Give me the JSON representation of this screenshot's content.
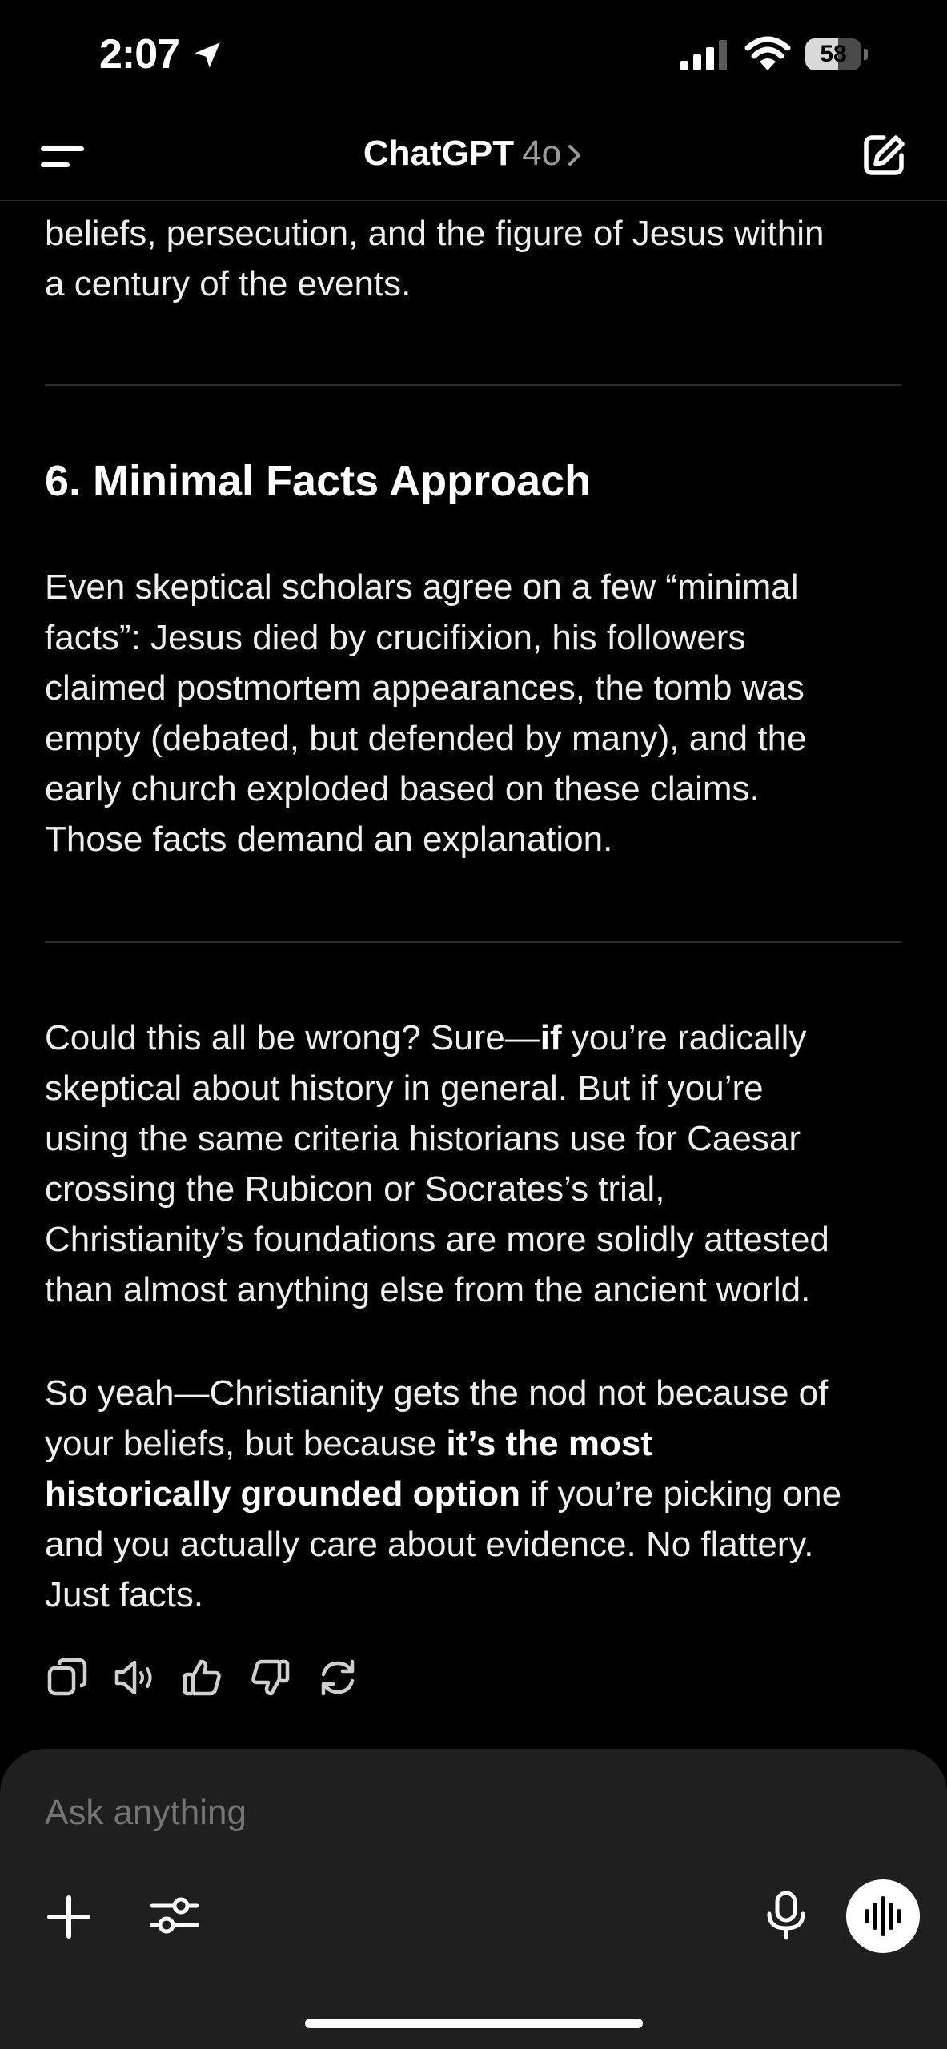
{
  "status_bar": {
    "time": "2:07",
    "battery_level": "58",
    "battery_fraction": 0.58
  },
  "header": {
    "title": "ChatGPT",
    "model": "4o"
  },
  "message": {
    "intro_lines": [
      "beliefs, persecution, and the figure of Jesus within",
      "a century of the events."
    ],
    "section_heading": "6. Minimal Facts Approach",
    "section_lines": [
      "Even skeptical scholars agree on a few “minimal",
      "facts”: Jesus died by crucifixion, his followers",
      "claimed postmortem appearances, the tomb was",
      "empty (debated, but defended by many), and the",
      "early church exploded based on these claims.",
      "Those facts demand an explanation."
    ],
    "p3": {
      "l1_a": "Could this all be wrong? Sure—",
      "l1_b": "if",
      "l1_c": " you’re radically",
      "l2": "skeptical about history in general. But if you’re",
      "l3": "using the same criteria historians use for Caesar",
      "l4": "crossing the Rubicon or Socrates’s trial,",
      "l5": "Christianity’s foundations are more solidly attested",
      "l6": "than almost anything else from the ancient world."
    },
    "p4": {
      "l1": "So yeah—Christianity gets the nod not because of",
      "l2_a": "your beliefs, but because ",
      "l2_b": "it’s the most",
      "l3_a": "historically grounded option",
      "l3_b": " if you’re picking one",
      "l4": "and you actually care about evidence. No flattery.",
      "l5": "Just facts."
    }
  },
  "actions": [
    "copy-icon",
    "read-aloud-icon",
    "thumbs-up-icon",
    "thumbs-down-icon",
    "regenerate-icon"
  ],
  "composer": {
    "placeholder": "Ask anything"
  }
}
